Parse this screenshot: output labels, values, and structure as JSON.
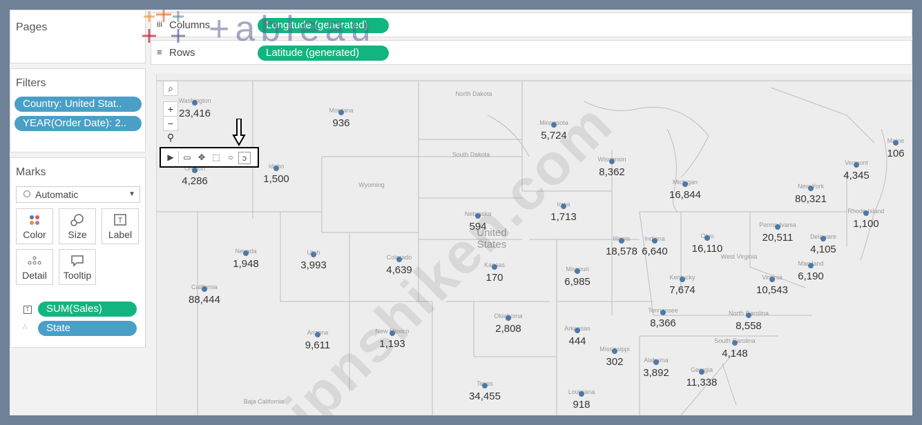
{
  "shelves": {
    "pages_label": "Pages",
    "columns_label": "Columns",
    "rows_label": "Rows",
    "columns_pill": "Longitude (generated)",
    "rows_pill": "Latitude (generated)"
  },
  "logo": {
    "text": "+ableau"
  },
  "filters": {
    "title": "Filters",
    "items": [
      "Country: United Stat..",
      "YEAR(Order Date): 2.."
    ]
  },
  "marks": {
    "title": "Marks",
    "mark_type": "Automatic",
    "buttons": [
      "Color",
      "Size",
      "Label",
      "Detail",
      "Tooltip"
    ],
    "fields": [
      "SUM(Sales)",
      "State"
    ]
  },
  "map": {
    "center_label": "United States",
    "states": [
      {
        "name": "Washington",
        "value": "23,416"
      },
      {
        "name": "Montana",
        "value": "936"
      },
      {
        "name": "North Dakota",
        "value": ""
      },
      {
        "name": "Minnesota",
        "value": "5,724"
      },
      {
        "name": "Maine",
        "value": "106"
      },
      {
        "name": "Oregon",
        "value": "4,286"
      },
      {
        "name": "Idaho",
        "value": "1,500"
      },
      {
        "name": "South Dakota",
        "value": ""
      },
      {
        "name": "Wyoming",
        "value": ""
      },
      {
        "name": "Wisconsin",
        "value": "8,362"
      },
      {
        "name": "Michigan",
        "value": "16,844"
      },
      {
        "name": "Vermont",
        "value": "4,345"
      },
      {
        "name": "New York",
        "value": "80,321"
      },
      {
        "name": "Nebraska",
        "value": "594"
      },
      {
        "name": "Iowa",
        "value": "1,713"
      },
      {
        "name": "Rhode Island",
        "value": "1,100"
      },
      {
        "name": "Pennsylvania",
        "value": "20,511"
      },
      {
        "name": "Nevada",
        "value": "1,948"
      },
      {
        "name": "Utah",
        "value": "3,993"
      },
      {
        "name": "Colorado",
        "value": "4,639"
      },
      {
        "name": "Illinois",
        "value": "18,578"
      },
      {
        "name": "Indiana",
        "value": "6,640"
      },
      {
        "name": "Ohio",
        "value": "16,110"
      },
      {
        "name": "Delaware",
        "value": "4,105"
      },
      {
        "name": "California",
        "value": "88,444"
      },
      {
        "name": "Kansas",
        "value": "170"
      },
      {
        "name": "Missouri",
        "value": "6,985"
      },
      {
        "name": "Kentucky",
        "value": "7,674"
      },
      {
        "name": "Virginia",
        "value": "10,543"
      },
      {
        "name": "Maryland",
        "value": "6,190"
      },
      {
        "name": "West Virginia",
        "value": ""
      },
      {
        "name": "Oklahoma",
        "value": "2,808"
      },
      {
        "name": "Tennessee",
        "value": "8,366"
      },
      {
        "name": "North Carolina",
        "value": "8,558"
      },
      {
        "name": "Arizona",
        "value": "9,611"
      },
      {
        "name": "New Mexico",
        "value": "1,193"
      },
      {
        "name": "Arkansas",
        "value": "444"
      },
      {
        "name": "South Carolina",
        "value": "4,148"
      },
      {
        "name": "Mississippi",
        "value": "302"
      },
      {
        "name": "Alabama",
        "value": "3,892"
      },
      {
        "name": "Georgia",
        "value": "11,338"
      },
      {
        "name": "Texas",
        "value": "34,455"
      },
      {
        "name": "Louisiana",
        "value": "918"
      },
      {
        "name": "Baja California",
        "value": ""
      }
    ]
  },
  "watermark": "jpnshiken.com",
  "colors": {
    "pill_blue": "#4a9fc6",
    "pill_green": "#12b57f",
    "mark": "#4e79a7"
  }
}
